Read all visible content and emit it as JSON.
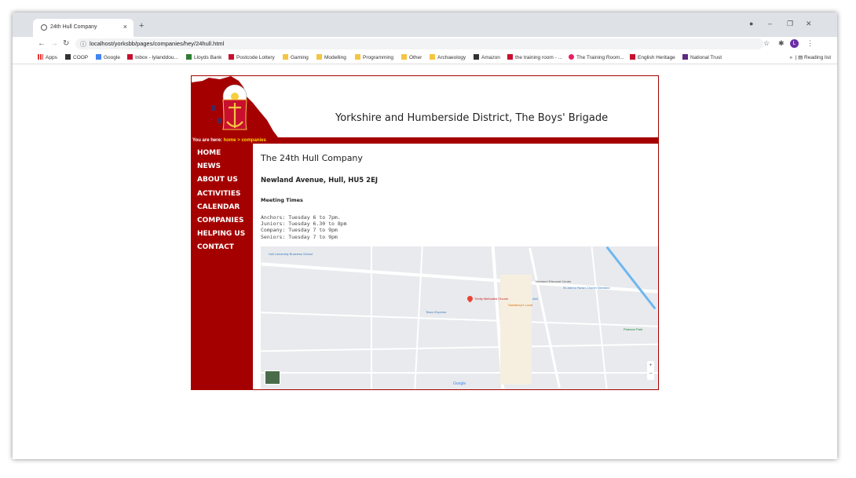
{
  "browser": {
    "tab_title": "24th Hull Company",
    "tab_close": "×",
    "new_tab": "+",
    "url": "localhost/yorksbb/pages/companies/hey/24hull.html",
    "avatar_letter": "L",
    "window_controls": [
      "–",
      "❐",
      "✕"
    ]
  },
  "bookmarks": [
    {
      "label": "Apps",
      "icon": "grid"
    },
    {
      "label": "COOP",
      "icon": "dark"
    },
    {
      "label": "Google",
      "icon": "blue"
    },
    {
      "label": "Inbox - lylanddou...",
      "icon": "red"
    },
    {
      "label": "Lloyds Bank",
      "icon": "green"
    },
    {
      "label": "Postcode Lottery",
      "icon": "red"
    },
    {
      "label": "Gaming",
      "icon": "folder"
    },
    {
      "label": "Modelling",
      "icon": "folder"
    },
    {
      "label": "Programming",
      "icon": "folder"
    },
    {
      "label": "Other",
      "icon": "folder"
    },
    {
      "label": "Archaeology",
      "icon": "folder"
    },
    {
      "label": "Amazon",
      "icon": "dark"
    },
    {
      "label": "the training room - ...",
      "icon": "red"
    },
    {
      "label": "The Training Room...",
      "icon": "pink"
    },
    {
      "label": "English Heritage",
      "icon": "red"
    },
    {
      "label": "National Trust",
      "icon": "purple"
    }
  ],
  "reading_list": "Reading list",
  "site": {
    "title": "Yorkshire and Humberside District, The Boys' Brigade",
    "breadcrumb_prefix": "You are here:",
    "breadcrumb_home": "home",
    "breadcrumb_sep": ">",
    "breadcrumb_current": "companies",
    "nav": [
      "HOME",
      "NEWS",
      "ABOUT US",
      "ACTIVITIES",
      "CALENDAR",
      "COMPANIES",
      "HELPING US",
      "CONTACT"
    ]
  },
  "content": {
    "heading": "The 24th Hull Company",
    "address": "Newland Avenue, Hull, HU5 2EJ",
    "meeting_heading": "Meeting Times",
    "times": [
      "Anchors: Tuesday 6 to 7pm.",
      "Juniors: Tuesday 6.30 to 8pm",
      "Company: Tuesday 7 to 9pm",
      "Seniors: Tuesday 7 to 9pm"
    ]
  },
  "map": {
    "labels": [
      "Hull University Business School",
      "Trinity Methodist Church",
      "Newland Discount Centre",
      "St John's Parish Church Newland",
      "Sainsbury's Local",
      "Aldi",
      "Tesco Express",
      "Pearson Park",
      "Google"
    ],
    "pin_color": "#ea4335"
  }
}
